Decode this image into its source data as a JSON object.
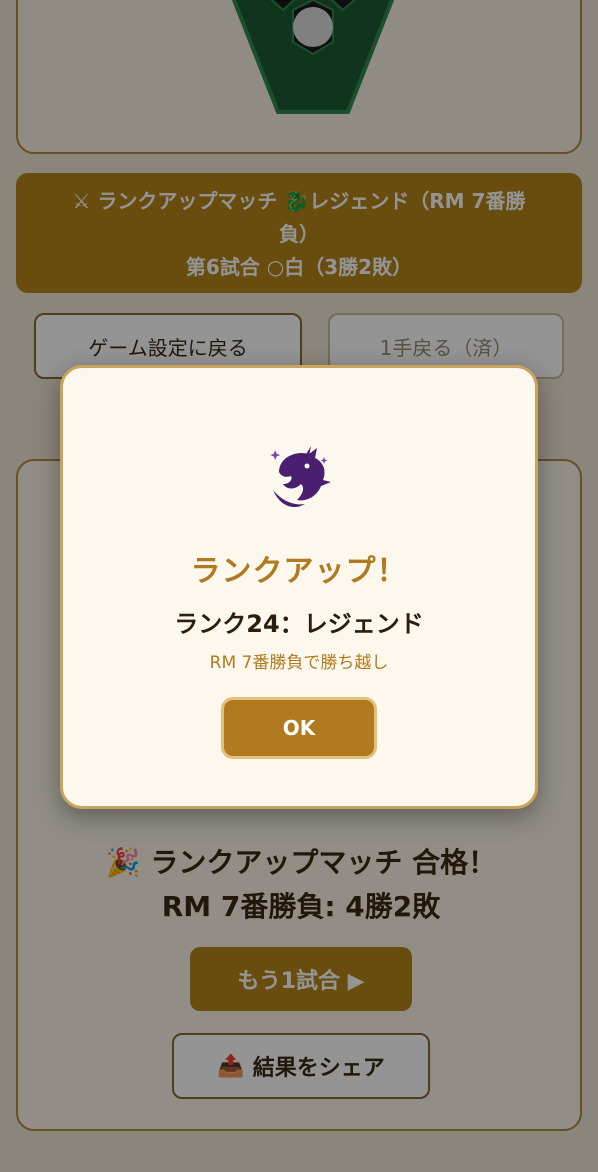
{
  "banner": {
    "line1": "⚔ ランクアップマッチ 🐉レジェンド（RM 7番勝",
    "line2": "負）",
    "line3": "第6試合 ○白（3勝2敗）"
  },
  "buttons": {
    "back_label": "ゲーム設定に戻る",
    "undo_label": "1手戻る（済）"
  },
  "result": {
    "title": "🎉 ランクアップマッチ 合格！",
    "score": "RM 7番勝負: 4勝2敗",
    "next_label": "もう1試合 ▶",
    "share_icon": "📤",
    "share_label": "結果をシェア"
  },
  "modal": {
    "icon": "dragon-icon",
    "title": "ランクアップ！",
    "rank": "ランク24：レジェンド",
    "description": "RM 7番勝負で勝ち越し",
    "ok_label": "OK"
  },
  "colors": {
    "accent": "#b58619",
    "modal_title": "#b27a1e",
    "dragon": "#4b1f6f"
  }
}
